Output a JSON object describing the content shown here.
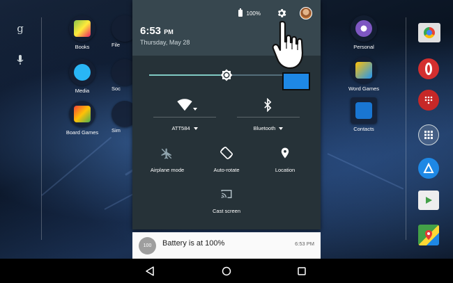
{
  "status_bar": {
    "battery_text": "100%",
    "battery_icon": "battery-icon",
    "settings_icon": "gear-icon",
    "avatar_icon": "avatar-icon"
  },
  "clock": {
    "time": "6:53",
    "ampm": "PM",
    "date": "Thursday, May 28"
  },
  "brightness": {
    "level": 0.5,
    "icon": "brightness-icon"
  },
  "quick_tiles": {
    "wifi": {
      "label": "ATT584",
      "icon": "wifi-icon"
    },
    "bluetooth": {
      "label": "Bluetooth",
      "icon": "bluetooth-icon"
    },
    "airplane": {
      "label": "Airplane mode",
      "icon": "airplane-icon"
    },
    "rotate": {
      "label": "Auto-rotate",
      "icon": "rotate-icon"
    },
    "location": {
      "label": "Location",
      "icon": "location-pin-icon"
    },
    "cast": {
      "label": "Cast screen",
      "icon": "cast-icon"
    }
  },
  "notification": {
    "badge": "100",
    "title": "Battery is at 100%",
    "time": "6:53 PM"
  },
  "home_apps_left": [
    {
      "label": "Books"
    },
    {
      "label": "Media"
    },
    {
      "label": "Board Games"
    }
  ],
  "home_apps_partial": [
    {
      "label": "File"
    },
    {
      "label": "Soc"
    },
    {
      "label": "Sim"
    }
  ],
  "home_apps_right": [
    {
      "label": "Personal"
    },
    {
      "label": "Word Games"
    },
    {
      "label": "Contacts"
    }
  ],
  "left_rail": {
    "google_icon": "google-g-icon",
    "mic_icon": "microphone-icon"
  },
  "right_dock_icons": [
    "chrome-icon",
    "opera-icon",
    "dialer-icon",
    "app-drawer-icon",
    "account-icon",
    "play-store-icon",
    "maps-icon"
  ],
  "navigation": {
    "back_icon": "back-icon",
    "home_icon": "home-icon",
    "recents_icon": "recents-icon"
  },
  "colors": {
    "shade_bg": "#263238",
    "shade_header": "#37474f",
    "accent": "#80cbc4",
    "highlight_box": "#1e88e5"
  }
}
